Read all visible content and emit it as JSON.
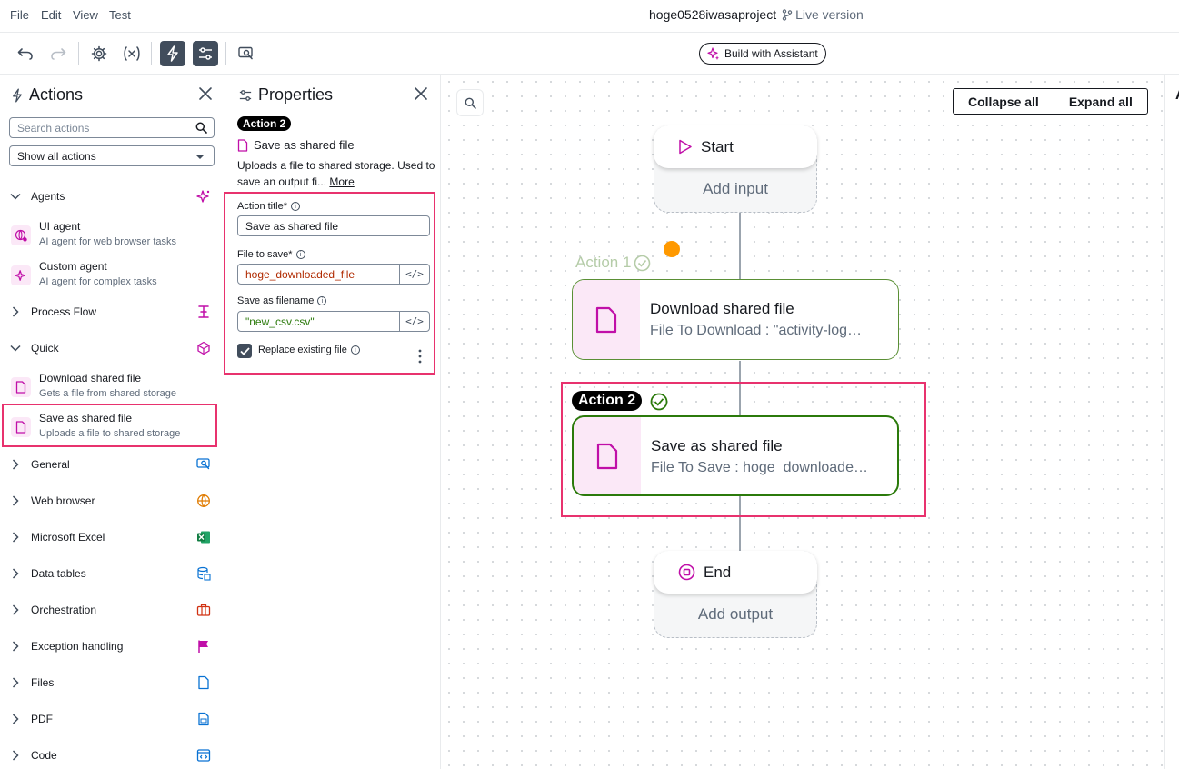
{
  "menu": [
    "File",
    "Edit",
    "View",
    "Test"
  ],
  "project": {
    "name": "hoge0528iwasaproject",
    "version": "Live version"
  },
  "toolbar": {
    "assistant_label": "Build with Assistant"
  },
  "actions_panel": {
    "title": "Actions",
    "search_placeholder": "Search actions",
    "filter_value": "Show all actions",
    "categories": {
      "agents": "Agents",
      "process_flow": "Process Flow",
      "quick": "Quick",
      "general": "General",
      "web_browser": "Web browser",
      "excel": "Microsoft Excel",
      "data_tables": "Data tables",
      "orchestration": "Orchestration",
      "exception": "Exception handling",
      "files": "Files",
      "pdf": "PDF",
      "code": "Code"
    },
    "items": {
      "ui_agent": {
        "name": "UI agent",
        "desc": "AI agent for web browser tasks"
      },
      "custom_agent": {
        "name": "Custom agent",
        "desc": "AI agent for complex tasks"
      },
      "download": {
        "name": "Download shared file",
        "desc": "Gets a file from shared storage"
      },
      "save": {
        "name": "Save as shared file",
        "desc": "Uploads a file to shared storage"
      }
    }
  },
  "properties": {
    "title": "Properties",
    "badge": "Action 2",
    "action_name": "Save as shared file",
    "desc": "Uploads a file to shared storage. Used to save an output fi...",
    "more": "More",
    "fields": {
      "title_label": "Action title*",
      "title_value": "Save as shared file",
      "file_label": "File to save*",
      "file_value": "hoge_downloaded_file",
      "filename_label": "Save as filename",
      "filename_value": "\"new_csv.csv\"",
      "code_glyph": "</>"
    },
    "checkbox_label": "Replace existing file",
    "checkbox_checked": true
  },
  "canvas": {
    "collapse": "Collapse all",
    "expand": "Expand all",
    "start": {
      "label": "Start",
      "sub": "Add input"
    },
    "action1": {
      "label": "Action 1",
      "title": "Download shared file",
      "sub": "File To Download : \"activity-log…"
    },
    "action2": {
      "label": "Action 2",
      "title": "Save as shared file",
      "sub": "File To Save : hoge_downloade…"
    },
    "end": {
      "label": "End",
      "sub": "Add output"
    },
    "right_edge_letter": "A"
  },
  "colors": {
    "highlight": "#e8326e",
    "success": "#2b7a0b",
    "magenta_icon": "#c00fa8",
    "pending_dot": "#ff9900"
  }
}
